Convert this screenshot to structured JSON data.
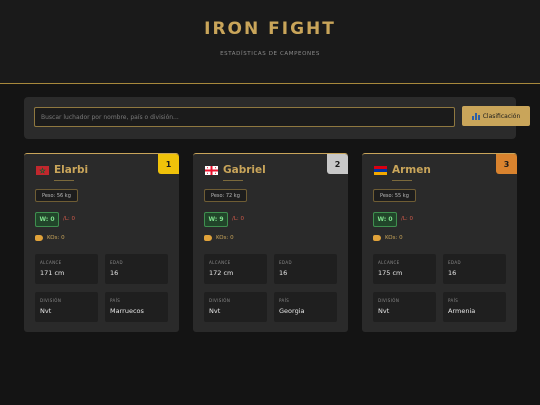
{
  "header": {
    "title": "IRON FIGHT",
    "subtitle": "ESTADÍSTICAS DE CAMPEONES"
  },
  "search": {
    "placeholder": "Buscar luchador por nombre, país o división...",
    "value": "",
    "button_label": "Clasificación",
    "button_icon": "bar-chart-icon"
  },
  "labels": {
    "reach": "ALCANCE",
    "age": "EDAD",
    "division": "DIVISIÓN",
    "country": "PAÍS"
  },
  "colors": {
    "accent": "#c9a55a",
    "rank_1": "#f0c20a",
    "rank_2": "#c8c8c8",
    "rank_3": "#d9832e",
    "wins": "#7ee08c",
    "losses": "#d05a4a"
  },
  "fighters": [
    {
      "rank": "1",
      "flag_icon": "morocco-flag-icon",
      "name": "Elarbi",
      "weight": "Peso: 56 kg",
      "wins": "W: 0",
      "losses": "/L: 0",
      "kos": "KOs: 0",
      "reach": "171 cm",
      "age": "16",
      "division": "Nvt",
      "country": "Marruecos"
    },
    {
      "rank": "2",
      "flag_icon": "georgia-flag-icon",
      "name": "Gabriel",
      "weight": "Peso: 72 kg",
      "wins": "W: 9",
      "losses": "/L: 0",
      "kos": "KOs: 0",
      "reach": "172 cm",
      "age": "16",
      "division": "Nvt",
      "country": "Georgia"
    },
    {
      "rank": "3",
      "flag_icon": "armenia-flag-icon",
      "name": "Armen",
      "weight": "Peso: 55 kg",
      "wins": "W: 0",
      "losses": "/L: 0",
      "kos": "KOs: 0",
      "reach": "175 cm",
      "age": "16",
      "division": "Nvt",
      "country": "Armenia"
    }
  ]
}
